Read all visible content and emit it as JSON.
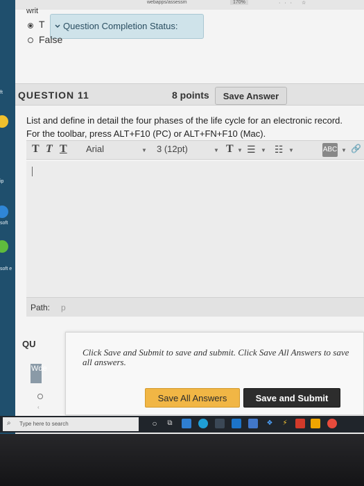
{
  "browser": {
    "url_fragment": "webapps/assessm",
    "zoom": "170%"
  },
  "desktop_icons": [
    "ft",
    "ip",
    "soft",
    "soft e"
  ],
  "previous_question": {
    "wrap_text": "writ",
    "status_label": "Question Completion Status:",
    "option_true": "T",
    "option_false": "False"
  },
  "question": {
    "title": "QUESTION 11",
    "points": "8 points",
    "save_label": "Save Answer",
    "prompt": "List and define in detail the four phases of the life cycle for an electronic record.",
    "toolbar_hint": "For the toolbar, press ALT+F10 (PC) or ALT+FN+F10 (Mac)."
  },
  "toolbar": {
    "bold": "T",
    "italic": "T",
    "underline": "T",
    "font": "Arial",
    "size": "3 (12pt)",
    "text_color": "T",
    "spell_badge": "ABC"
  },
  "editor": {
    "path_label": "Path:",
    "path_value": "p"
  },
  "next_question": {
    "title_stub": "QU",
    "mini_text": "Wde"
  },
  "submit": {
    "message": "Click Save and Submit to save and submit. Click Save All Answers to save all answers.",
    "save_all_label": "Save All Answers",
    "save_submit_label": "Save and Submit"
  },
  "taskbar": {
    "search_placeholder": "Type here to search"
  },
  "colors": {
    "status_bg": "#cfe3ea",
    "save_all_bg": "#f1b645",
    "save_submit_bg": "#2d2d2d"
  }
}
